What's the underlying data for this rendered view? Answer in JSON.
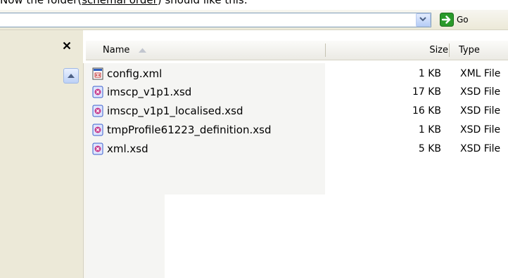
{
  "caption": {
    "before": "Now the folder(",
    "link": "schemal order",
    "after": ") should like this:"
  },
  "address_bar": {
    "value": "",
    "go_label": "Go"
  },
  "task_pane": {
    "close_glyph": "✕"
  },
  "columns": {
    "name": "Name",
    "size": "Size",
    "type": "Type"
  },
  "files": [
    {
      "name": "config.xml",
      "size": "1 KB",
      "type": "XML File",
      "icon": "xml-file-icon"
    },
    {
      "name": "imscp_v1p1.xsd",
      "size": "17 KB",
      "type": "XSD File",
      "icon": "xsd-file-icon"
    },
    {
      "name": "imscp_v1p1_localised.xsd",
      "size": "16 KB",
      "type": "XSD File",
      "icon": "xsd-file-icon"
    },
    {
      "name": "tmpProfile61223_definition.xsd",
      "size": "1 KB",
      "type": "XSD File",
      "icon": "xsd-file-icon"
    },
    {
      "name": "xml.xsd",
      "size": "5 KB",
      "type": "XSD File",
      "icon": "xsd-file-icon"
    }
  ],
  "colors": {
    "accent_green": "#2a9a2a",
    "xp_bar": "#ece9d8",
    "xsd_icon": "#3a5fcd"
  }
}
